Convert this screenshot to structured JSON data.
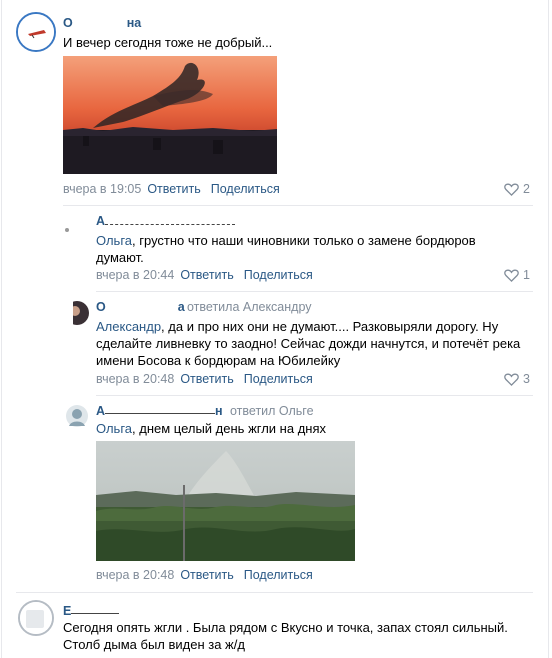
{
  "comments": [
    {
      "author": "О",
      "author_suffix": "на",
      "text": "И вечер сегодня тоже не добрый...",
      "time": "вчера в 19:05",
      "reply_label": "Ответить",
      "share_label": "Поделиться",
      "likes": "2",
      "photo": "sunset-smoke-photo"
    },
    {
      "author": "А",
      "mention": "Ольга",
      "text": ", грустно что наши чиновники только о замене бордюров думают.",
      "time": "вчера в 20:44",
      "reply_label": "Ответить",
      "share_label": "Поделиться",
      "likes": "1"
    },
    {
      "author": "О",
      "author_suffix": "а",
      "reply_to": "ответила Александру",
      "mention": "Александр",
      "text": ", да и про них они не думают.... Разковыряли дорогу. Ну сделайте ливневку то заодно! Сейчас дожди начнутся, и потечёт река имени Босова к бордюрам на Юбилейку",
      "time": "вчера в 20:48",
      "reply_label": "Ответить",
      "share_label": "Поделиться",
      "likes": "3"
    },
    {
      "author": "А",
      "author_suffix": "н",
      "reply_to": "ответил Ольге",
      "mention": "Ольга",
      "text": ", днем целый день жгли на днях",
      "time": "вчера в 20:48",
      "reply_label": "Ответить",
      "share_label": "Поделиться",
      "photo": "forest-smoke-photo"
    },
    {
      "author": "Е",
      "text": "Сегодня опять жгли . Была рядом с Вкусно и точка, запах стоял сильный. Столб дыма был виден за ж/д"
    }
  ],
  "colors": {
    "link": "#2a5885",
    "meta": "#818c99",
    "heart": "#818c99",
    "divider": "#e7e8ec"
  },
  "icons": {
    "like": "heart-icon"
  }
}
